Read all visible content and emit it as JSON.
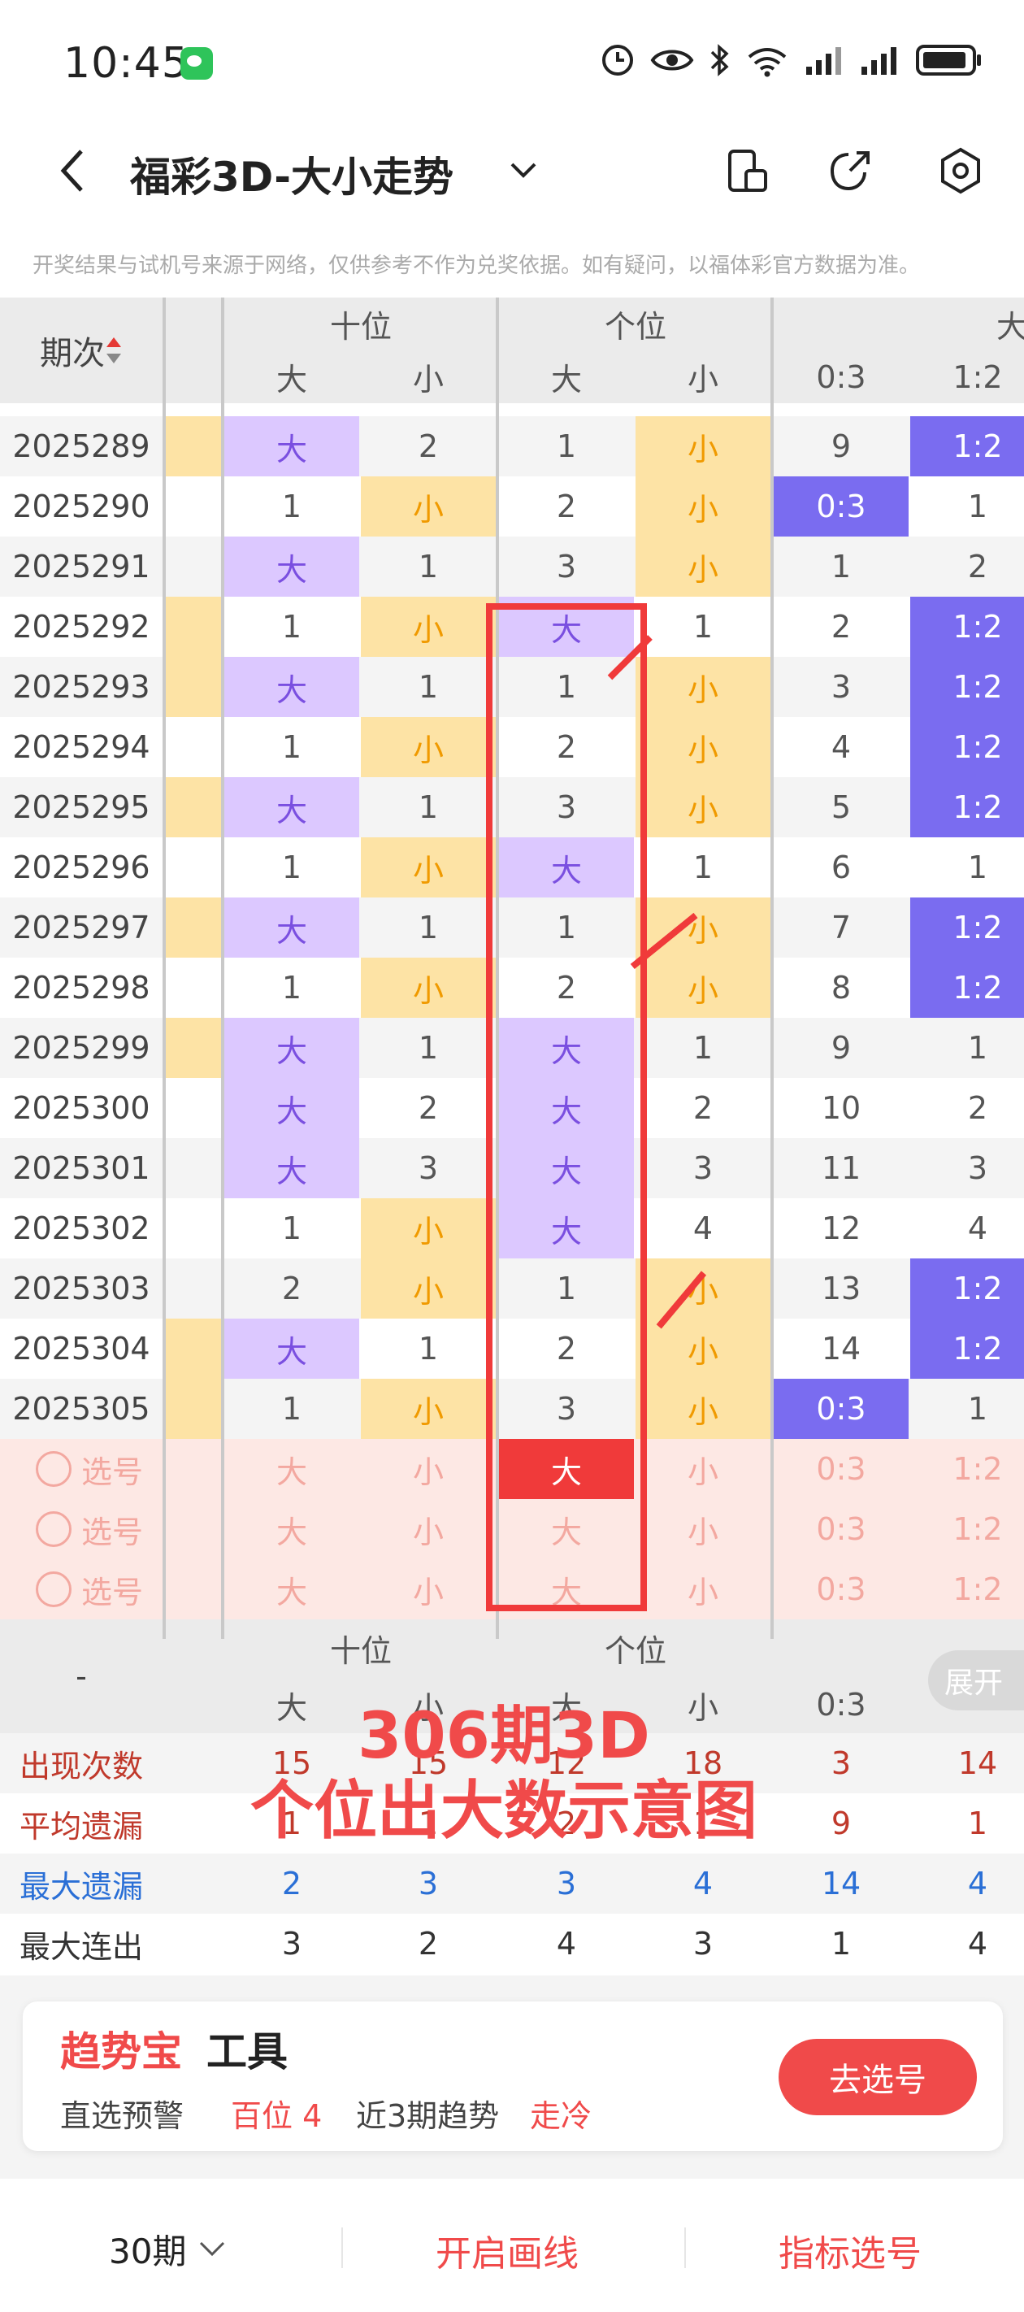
{
  "status": {
    "time": "10:45"
  },
  "nav": {
    "title": "福彩3D-大小走势"
  },
  "disclaimer": "开奖结果与试机号来源于网络，仅供参考不作为兑奖依据。如有疑问，以福体彩官方数据为准。",
  "table": {
    "period_header": "期次",
    "group_shi": "十位",
    "group_ge": "个位",
    "group_ratio_partial": "大",
    "sub_big": "大",
    "sub_small": "小",
    "ratio_03": "0:3",
    "ratio_12": "1:2",
    "rows": [
      {
        "period": "2025289",
        "s": [
          "大",
          "2"
        ],
        "g": [
          "1",
          "小"
        ],
        "r": [
          "9",
          "1:2"
        ],
        "sb": 0,
        "gb": 1,
        "rb": 1,
        "edge": 1
      },
      {
        "period": "2025290",
        "s": [
          "1",
          "小"
        ],
        "g": [
          "2",
          "小"
        ],
        "r": [
          "0:3",
          "1"
        ],
        "sb": 1,
        "gb": 1,
        "rb": 0,
        "edge": 0
      },
      {
        "period": "2025291",
        "s": [
          "大",
          "1"
        ],
        "g": [
          "3",
          "小"
        ],
        "r": [
          "1",
          "2"
        ],
        "sb": 0,
        "gb": 1,
        "rb": -1,
        "edge": 0
      },
      {
        "period": "2025292",
        "s": [
          "1",
          "小"
        ],
        "g": [
          "大",
          "1"
        ],
        "r": [
          "2",
          "1:2"
        ],
        "sb": 1,
        "gb": 0,
        "rb": 1,
        "edge": 1
      },
      {
        "period": "2025293",
        "s": [
          "大",
          "1"
        ],
        "g": [
          "1",
          "小"
        ],
        "r": [
          "3",
          "1:2"
        ],
        "sb": 0,
        "gb": 1,
        "rb": 1,
        "edge": 1
      },
      {
        "period": "2025294",
        "s": [
          "1",
          "小"
        ],
        "g": [
          "2",
          "小"
        ],
        "r": [
          "4",
          "1:2"
        ],
        "sb": 1,
        "gb": 1,
        "rb": 1,
        "edge": 0
      },
      {
        "period": "2025295",
        "s": [
          "大",
          "1"
        ],
        "g": [
          "3",
          "小"
        ],
        "r": [
          "5",
          "1:2"
        ],
        "sb": 0,
        "gb": 1,
        "rb": 1,
        "edge": 1
      },
      {
        "period": "2025296",
        "s": [
          "1",
          "小"
        ],
        "g": [
          "大",
          "1"
        ],
        "r": [
          "6",
          "1"
        ],
        "sb": 1,
        "gb": 0,
        "rb": -1,
        "edge": 0
      },
      {
        "period": "2025297",
        "s": [
          "大",
          "1"
        ],
        "g": [
          "1",
          "小"
        ],
        "r": [
          "7",
          "1:2"
        ],
        "sb": 0,
        "gb": 1,
        "rb": 1,
        "edge": 1
      },
      {
        "period": "2025298",
        "s": [
          "1",
          "小"
        ],
        "g": [
          "2",
          "小"
        ],
        "r": [
          "8",
          "1:2"
        ],
        "sb": 1,
        "gb": 1,
        "rb": 1,
        "edge": 0
      },
      {
        "period": "2025299",
        "s": [
          "大",
          "1"
        ],
        "g": [
          "大",
          "1"
        ],
        "r": [
          "9",
          "1"
        ],
        "sb": 0,
        "gb": 0,
        "rb": -1,
        "edge": 1
      },
      {
        "period": "2025300",
        "s": [
          "大",
          "2"
        ],
        "g": [
          "大",
          "2"
        ],
        "r": [
          "10",
          "2"
        ],
        "sb": 0,
        "gb": 0,
        "rb": -1,
        "edge": 0
      },
      {
        "period": "2025301",
        "s": [
          "大",
          "3"
        ],
        "g": [
          "大",
          "3"
        ],
        "r": [
          "11",
          "3"
        ],
        "sb": 0,
        "gb": 0,
        "rb": -1,
        "edge": 0
      },
      {
        "period": "2025302",
        "s": [
          "1",
          "小"
        ],
        "g": [
          "大",
          "4"
        ],
        "r": [
          "12",
          "4"
        ],
        "sb": 1,
        "gb": 0,
        "rb": -1,
        "edge": 0
      },
      {
        "period": "2025303",
        "s": [
          "2",
          "小"
        ],
        "g": [
          "1",
          "小"
        ],
        "r": [
          "13",
          "1:2"
        ],
        "sb": 1,
        "gb": 1,
        "rb": 1,
        "edge": 0
      },
      {
        "period": "2025304",
        "s": [
          "大",
          "1"
        ],
        "g": [
          "2",
          "小"
        ],
        "r": [
          "14",
          "1:2"
        ],
        "sb": 0,
        "gb": 1,
        "rb": 1,
        "edge": 1
      },
      {
        "period": "2025305",
        "s": [
          "1",
          "小"
        ],
        "g": [
          "3",
          "小"
        ],
        "r": [
          "0:3",
          "1"
        ],
        "sb": 1,
        "gb": 1,
        "rb": 0,
        "edge": 1
      }
    ],
    "pick_label": "选号",
    "pick_selected": "大"
  },
  "stats": {
    "dash": "-",
    "expand": "展开",
    "rows": [
      {
        "label": "出现次数",
        "vals": [
          "15",
          "15",
          "12",
          "18",
          "3",
          "14"
        ],
        "color": "#c0392b"
      },
      {
        "label": "平均遗漏",
        "vals": [
          "1",
          "1",
          "2",
          "1",
          "9",
          "1"
        ],
        "color": "#c0392b"
      },
      {
        "label": "最大遗漏",
        "vals": [
          "2",
          "3",
          "3",
          "4",
          "14",
          "4"
        ],
        "color": "#2a6fd6"
      },
      {
        "label": "最大连出",
        "vals": [
          "3",
          "2",
          "4",
          "3",
          "1",
          "4"
        ],
        "color": "#333"
      }
    ]
  },
  "overlay": {
    "line1": "306期3D",
    "line2": "个位出大数示意图"
  },
  "tool": {
    "brand": "趋势宝",
    "title": "工具",
    "label1": "直选预警",
    "value1": "百位 4",
    "label2": "近3期趋势",
    "value2": "走冷",
    "button": "去选号"
  },
  "bottom": {
    "periods": "30期",
    "draw_line": "开启画线",
    "indicator": "指标选号"
  },
  "colors": {
    "accent": "#f04a4a",
    "big_bg": "#dcc8ff",
    "small_bg": "#fde3a5",
    "ratio_bg": "#7a6cf0"
  }
}
